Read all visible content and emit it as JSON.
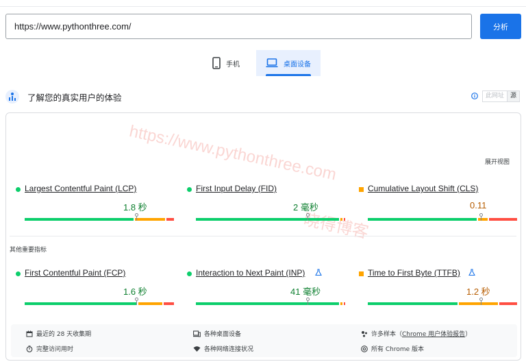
{
  "search": {
    "url_value": "https://www.pythonthree.com/",
    "analyze_label": "分析"
  },
  "tabs": [
    {
      "label": "手机",
      "icon": "phone-icon",
      "active": false
    },
    {
      "label": "桌面设备",
      "icon": "laptop-icon",
      "active": true
    }
  ],
  "field_section": {
    "title": "了解您的真实用户的体验",
    "toggle_left": "此网址",
    "toggle_right": "源",
    "expand_label": "展开视图",
    "other_metrics_label": "其他重要指标"
  },
  "watermark": {
    "line1": "https://www.pythonthree.com",
    "line2": "晓得博客"
  },
  "core_metrics": [
    {
      "name": "Largest Contentful Paint (LCP)",
      "value": "1.8 秒",
      "status": "good",
      "good_pct": 74,
      "avg_pct": 21,
      "poor_pct": 5,
      "marker_pct": 75
    },
    {
      "name": "First Input Delay (FID)",
      "value": "2 毫秒",
      "status": "good",
      "good_pct": 97,
      "avg_pct": 2,
      "poor_pct": 1,
      "marker_pct": 75
    },
    {
      "name": "Cumulative Layout Shift (CLS)",
      "value": "0.11",
      "status": "average",
      "good_pct": 74,
      "avg_pct": 7,
      "poor_pct": 19,
      "marker_pct": 76
    }
  ],
  "other_metrics": [
    {
      "name": "First Contentful Paint (FCP)",
      "value": "1.6 秒",
      "status": "good",
      "lab_icon": false,
      "good_pct": 76,
      "avg_pct": 17,
      "poor_pct": 7,
      "marker_pct": 75
    },
    {
      "name": "Interaction to Next Paint (INP)",
      "value": "41 毫秒",
      "status": "good",
      "lab_icon": true,
      "good_pct": 97,
      "avg_pct": 2,
      "poor_pct": 1,
      "marker_pct": 75
    },
    {
      "name": "Time to First Byte (TTFB)",
      "value": "1.2 秒",
      "status": "average",
      "lab_icon": true,
      "good_pct": 61,
      "avg_pct": 27,
      "poor_pct": 12,
      "marker_pct": 76
    }
  ],
  "footer": {
    "collection_period": "最近的 28 天收集期",
    "full_visit": "完整访问用时",
    "devices": "各种桌面设备",
    "network": "各种网络连接状况",
    "samples_prefix": "许多样本（",
    "samples_link": "Chrome 用户体验报告",
    "samples_suffix": "）",
    "chrome_versions": "所有 Chrome 版本"
  },
  "colors": {
    "accent": "#1a73e8",
    "good": "#0cce6b",
    "average": "#ffa400",
    "poor": "#ff4e42"
  }
}
